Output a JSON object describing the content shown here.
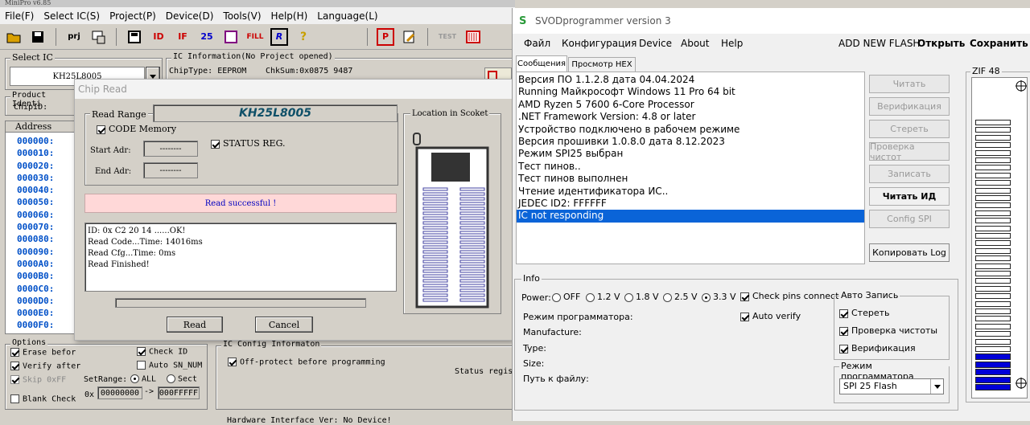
{
  "minipro": {
    "title": "MiniPro v6.85",
    "menu": [
      "File(F)",
      "Select IC(S)",
      "Project(P)",
      "Device(D)",
      "Tools(V)",
      "Help(H)",
      "Language(L)"
    ],
    "toolbar_icons": [
      "open-icon",
      "save-icon",
      "prj-icon",
      "chip-icon",
      "disk-icon",
      "id-icon",
      "read-icon",
      "verify-icon",
      "edit-icon",
      "fill-icon",
      "r-icon",
      "help-icon",
      "p-icon",
      "config-icon",
      "test-icon",
      "socket-icon"
    ],
    "toolbar_text": {
      "prj": "prj",
      "fill": "FILL",
      "r": "R",
      "test": "TEST"
    },
    "select_ic_label": "Select IC",
    "selected_chip": "KH25L8005",
    "ic_info_label": "IC Information(No Project opened)",
    "chip_type": "ChipType:  EEPROM",
    "chksum": "ChkSum:0x0875 9487",
    "product_ident_label": "Product Identi",
    "chipid_label": "ChipID:",
    "address_header": "Address",
    "addresses": [
      "000000:",
      "000010:",
      "000020:",
      "000030:",
      "000040:",
      "000050:",
      "000060:",
      "000070:",
      "000080:",
      "000090:",
      "0000A0:",
      "0000B0:",
      "0000C0:",
      "0000D0:",
      "0000E0:",
      "0000F0:"
    ],
    "options_label": "Options",
    "opt_erase": "Erase befor",
    "opt_verify": "Verify after",
    "opt_skip": "Skip 0xFF",
    "opt_blank": "Blank Check",
    "opt_checkid": "Check ID",
    "opt_autosn": "Auto SN_NUM",
    "setrange_label": "SetRange:",
    "range_all": "ALL",
    "range_sect": "Sect",
    "range_prefix": "0x",
    "range_start": "00000000",
    "range_arrow": "->",
    "range_end": "000FFFFF",
    "icconfig_label": "IC Config Informaton",
    "offprotect": "Off-protect before programming",
    "status_regis": "Status regis",
    "bottom_status": "Hardware Interface Ver: No Device!"
  },
  "chipread": {
    "title": "Chip Read",
    "read_range_label": "Read Range",
    "chip_name": "KH25L8005",
    "code_memory": "CODE Memory",
    "status_reg": "STATUS REG.",
    "start_adr_label": "Start Adr:",
    "end_adr_label": "End Adr:",
    "start_adr": "--------",
    "end_adr": "--------",
    "location_label": "Location in Scoket",
    "status_message": "Read successful !",
    "log": [
      "ID: 0x C2 20 14 ......OK!",
      "Read Code...Time: 14016ms",
      "Read Cfg...Time: 0ms",
      "Read Finished!"
    ],
    "read_button": "Read",
    "cancel_button": "Cancel"
  },
  "svod": {
    "title": "SVODprogrammer version 3",
    "menu": [
      "Файл",
      "Конфигурация",
      "Device",
      "About",
      "Help"
    ],
    "menu_right": [
      "ADD NEW FLASH",
      "Открыть",
      "Сохранить"
    ],
    "tabs": [
      "Сообщения",
      "Просмотр HEX"
    ],
    "log": [
      "Версия ПО 1.1.2.8 дата 04.04.2024",
      "Running Майкрософт Windows 11 Pro 64 bit",
      "AMD Ryzen 5 7600 6-Core Processor",
      ".NET Framework Version: 4.8 or later",
      "Устройство подключено в рабочем режиме",
      "Версия прошивки 1.0.8.0 дата 8.12.2023",
      "Режим SPI25 выбран",
      "Тест пинов..",
      "Тест пинов выполнен",
      "Чтение идентификатора ИС..",
      "JEDEC ID2: FFFFFF",
      "IC not responding"
    ],
    "buttons": [
      "Читать",
      "Верификация",
      "Стереть",
      "Проверка чистот",
      "Записать",
      "Читать ИД",
      "Config SPI",
      "Копировать Log"
    ],
    "zif_label": "ZIF 48",
    "info_label": "Info",
    "power_label": "Power:",
    "power_options": [
      "OFF",
      "1.2 V",
      "1.8 V",
      "2.5 V",
      "3.3 V"
    ],
    "check_pins": "Check pins connect",
    "auto_verify": "Auto verify",
    "programmer_mode_label": "Режим программатора:",
    "manufacture_label": "Manufacture:",
    "type_label": "Type:",
    "size_label": "Size:",
    "path_label": "Путь к файлу:",
    "auto_write_label": "Авто Запись",
    "aw_erase": "Стереть",
    "aw_blank": "Проверка чистоты",
    "aw_verify": "Верификация",
    "mode_group_label": "Режим программатора",
    "mode_value": "SPI 25 Flash"
  }
}
